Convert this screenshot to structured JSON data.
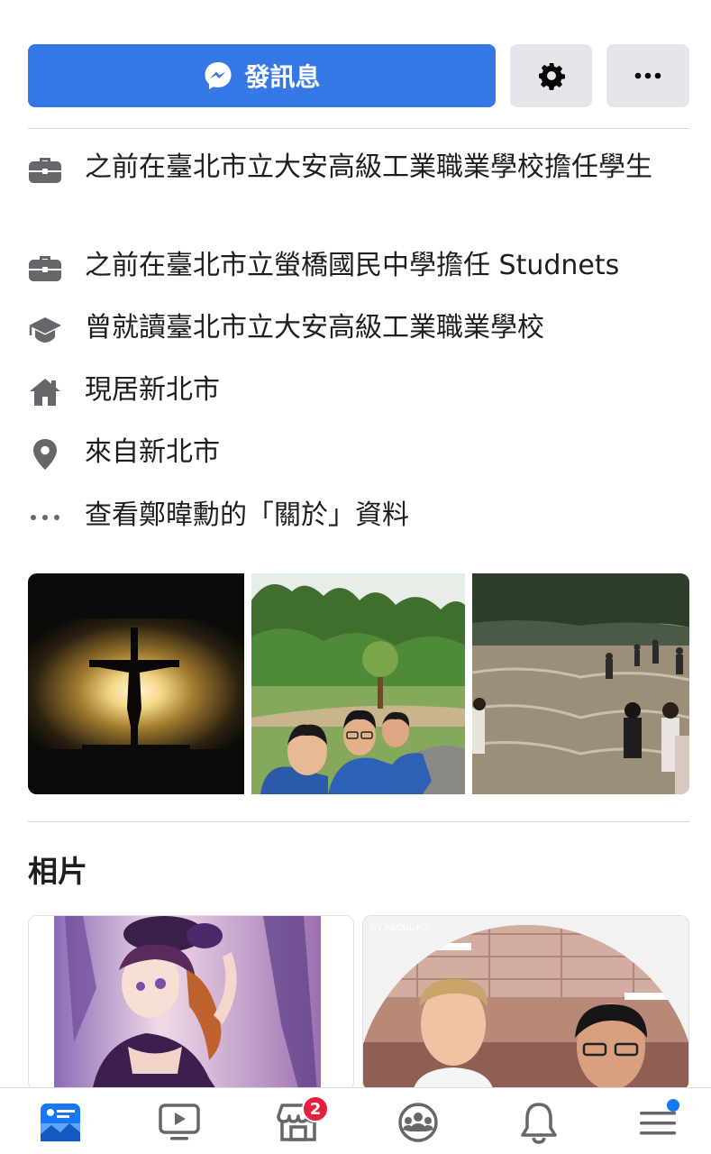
{
  "actions": {
    "message_label": "發訊息"
  },
  "intro": {
    "items": [
      {
        "icon": "briefcase-icon",
        "text": "之前在臺北市立大安高級工業職業學校擔任學生"
      },
      {
        "icon": "briefcase-icon",
        "text": "之前在臺北市立螢橋國民中學擔任 Studnets"
      },
      {
        "icon": "graduation-cap-icon",
        "text": "曾就讀臺北市立大安高級工業職業學校"
      },
      {
        "icon": "home-icon",
        "text": "現居新北市"
      },
      {
        "icon": "location-pin-icon",
        "text": "來自新北市"
      },
      {
        "icon": "ellipsis-icon",
        "text": "查看鄭暐勳的「關於」資料"
      }
    ]
  },
  "featured": {
    "photos": [
      "crucifix-sunset",
      "three-students-park",
      "kids-in-river"
    ]
  },
  "photos_section": {
    "title": "相片",
    "watermark": "BY ABDUL KG"
  },
  "nav": {
    "items": [
      "profile-tab",
      "watch-tab",
      "marketplace-tab",
      "groups-tab",
      "notifications-tab",
      "menu-tab"
    ],
    "marketplace_badge": "2"
  },
  "colors": {
    "primary": "#3578e5",
    "secondary_button": "#e4e6eb",
    "icon_gray": "#65676b",
    "badge": "#e41e3f"
  }
}
